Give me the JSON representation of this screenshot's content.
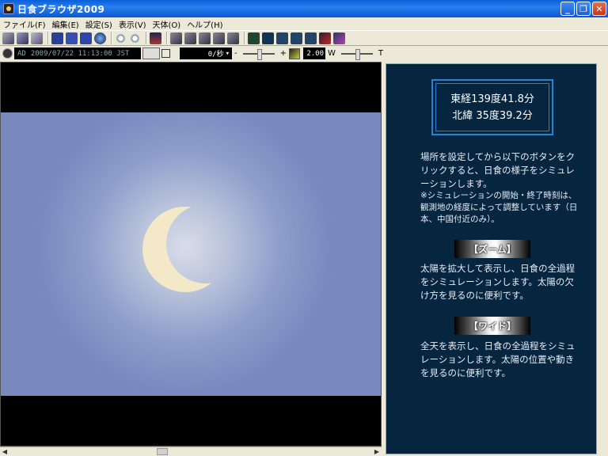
{
  "window": {
    "title": "日食ブラウザ2009"
  },
  "menu": [
    "ファイル(F)",
    "編集(E)",
    "設定(S)",
    "表示(V)",
    "天体(O)",
    "ヘルプ(H)"
  ],
  "toolbar2": {
    "era": "AD",
    "datetime": "2009/07/22  11:13:00 JST",
    "speed": "0/秒",
    "minus": "-",
    "plus": "+",
    "zoom": "2.00",
    "w_label": "W",
    "t_label": "T"
  },
  "location": {
    "longitude": "東経139度41.8分",
    "latitude": "北緯 35度39.2分"
  },
  "info": {
    "intro": "場所を設定してから以下のボタンをクリックすると、日食の様子をシミュレーションします。",
    "note": "※シミュレーションの開始・終了時刻は、観測地の経度によって調整しています（日本、中国付近のみ）。",
    "zoom_button": "【ズーム】",
    "zoom_desc": "太陽を拡大して表示し、日食の全過程をシミュレーションします。太陽の欠け方を見るのに便利です。",
    "wide_button": "【ワイド】",
    "wide_desc": "全天を表示し、日食の全過程をシミュレーションします。太陽の位置や動きを見るのに便利です。"
  },
  "icons": {
    "toolbar1": [
      "open-icon",
      "save-icon",
      "print-icon",
      "view-1-icon",
      "view-2-icon",
      "view-3-icon",
      "globe-icon",
      "zoom-in-icon",
      "zoom-out-icon",
      "chart-icon",
      "map-1-icon",
      "map-2-icon",
      "map-3-icon",
      "map-4-icon",
      "map-5-icon",
      "star-1-icon",
      "star-2-icon",
      "star-3-icon",
      "star-4-icon",
      "star-5-icon",
      "comet-icon",
      "meteor-icon"
    ]
  },
  "colors": {
    "accent": "#2e7dd7",
    "panel_bg": "#06253f",
    "sky": "#8c9ccb",
    "sun": "#f3e9c8"
  }
}
